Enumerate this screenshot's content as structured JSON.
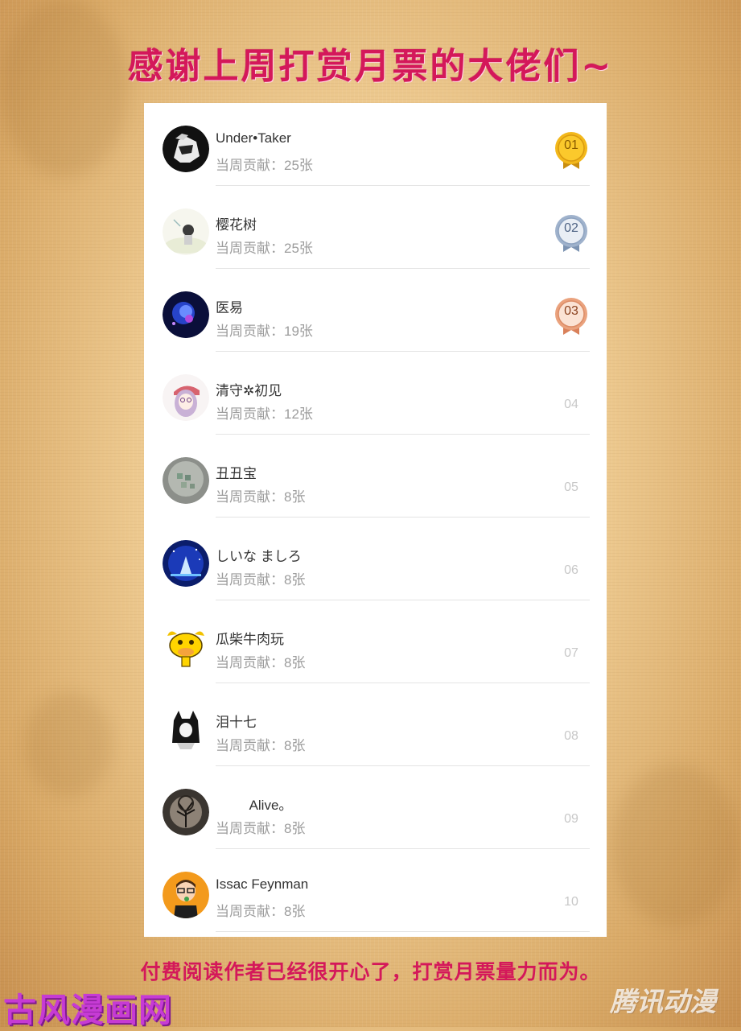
{
  "title": "感谢上周打赏月票的大佬们~",
  "colors": {
    "accent": "#d4185a",
    "gold": "#e6a312",
    "silver": "#7e95b4",
    "bronze": "#d98c63"
  },
  "ranking": [
    {
      "rank": "01",
      "name": "Under•Taker",
      "contribution": "当周贡献：25张",
      "badge": "gold-medal"
    },
    {
      "rank": "02",
      "name": "樱花树",
      "contribution": "当周贡献：25张",
      "badge": "silver-medal"
    },
    {
      "rank": "03",
      "name": "医易",
      "contribution": "当周贡献：19张",
      "badge": "bronze-medal"
    },
    {
      "rank": "04",
      "name": "清守✲初见",
      "contribution": "当周贡献：12张",
      "badge": "none"
    },
    {
      "rank": "05",
      "name": "丑丑宝",
      "contribution": "当周贡献：8张",
      "badge": "none"
    },
    {
      "rank": "06",
      "name": "しいな ましろ",
      "contribution": "当周贡献：8张",
      "badge": "none"
    },
    {
      "rank": "07",
      "name": "瓜柴牛肉玩",
      "contribution": "当周贡献：8张",
      "badge": "none"
    },
    {
      "rank": "08",
      "name": "泪十七",
      "contribution": "当周贡献：8张",
      "badge": "none"
    },
    {
      "rank": "09",
      "name": "         Alive。",
      "contribution": "当周贡献：8张",
      "badge": "none"
    },
    {
      "rank": "10",
      "name": "Issac Feynman",
      "contribution": "当周贡献：8张",
      "badge": "none"
    }
  ],
  "footer": "付费阅读作者已经很开心了，打赏月票量力而为。",
  "watermarks": {
    "left": "古风漫画网",
    "right": "腾讯动漫"
  }
}
